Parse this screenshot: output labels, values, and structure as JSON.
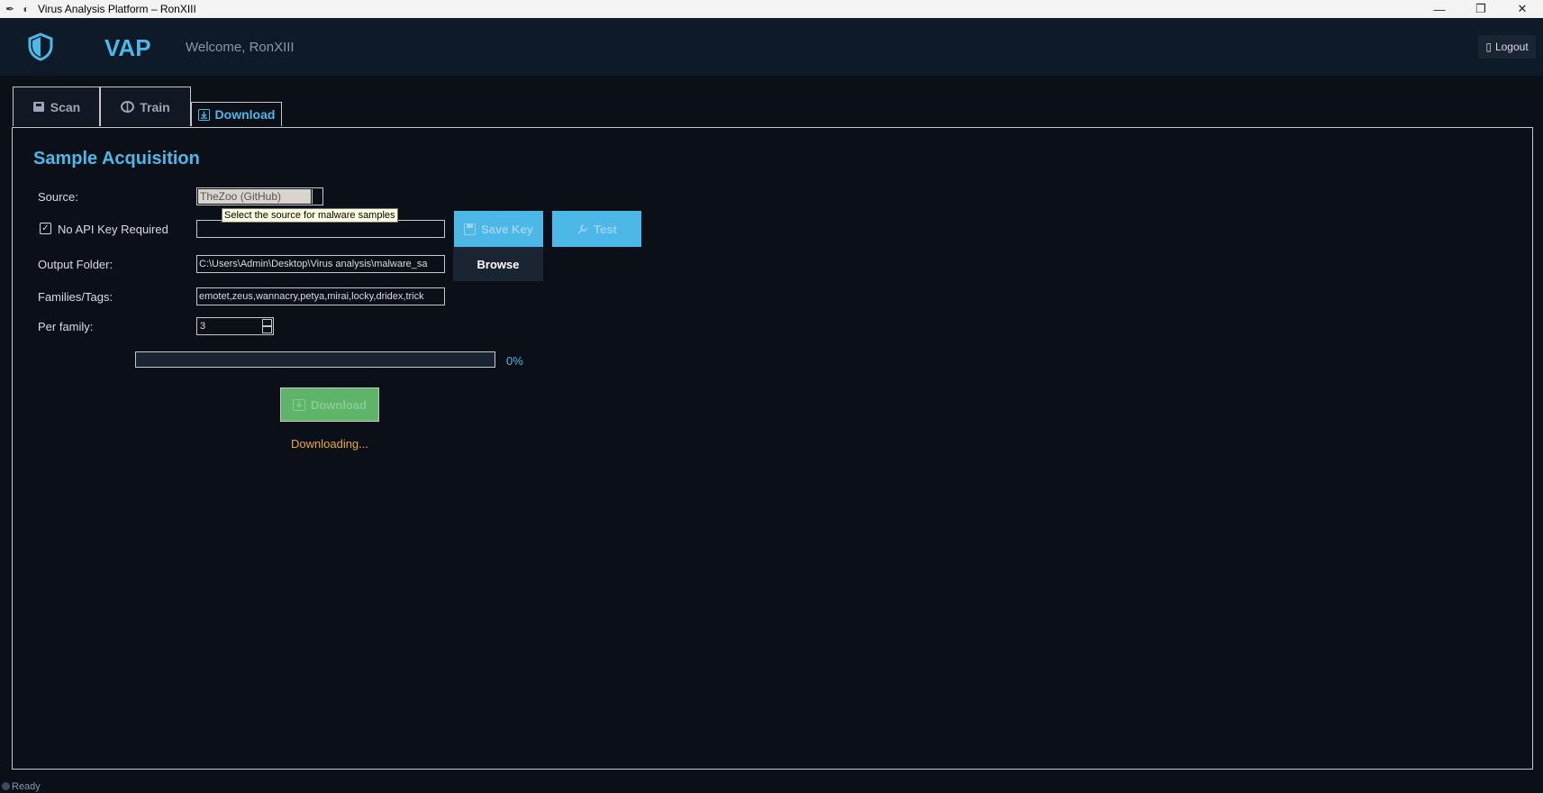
{
  "window": {
    "title": "Virus Analysis Platform – RonXIII",
    "minimize": "—",
    "restore": "❐",
    "close": "✕"
  },
  "header": {
    "app_name": "VAP",
    "welcome": "Welcome, RonXIII",
    "logout_label": "Logout",
    "logout_icon": "▯"
  },
  "tabs": [
    {
      "label": "Scan",
      "icon": "scan-icon"
    },
    {
      "label": "Train",
      "icon": "brain-icon"
    },
    {
      "label": "Download",
      "icon": "download-icon",
      "active": true
    }
  ],
  "main": {
    "title": "Sample Acquisition",
    "source_label": "Source:",
    "source_value": "TheZoo (GitHub)",
    "source_tooltip": "Select the source for malware samples",
    "no_api_key_label": "No API Key Required",
    "no_api_key_checked": true,
    "api_key_value": "",
    "save_key_label": "Save Key",
    "test_label": "Test",
    "output_label": "Output Folder:",
    "output_value": "C:\\Users\\Admin\\Desktop\\Virus analysis\\malware_sa",
    "browse_label": "Browse",
    "families_label": "Families/Tags:",
    "families_value": "emotet,zeus,wannacry,petya,mirai,locky,dridex,trick",
    "per_family_label": "Per family:",
    "per_family_value": "3",
    "progress_fraction": 0,
    "progress_text": "0%",
    "download_label": "Download",
    "download_status": "Downloading..."
  },
  "statusbar": {
    "text": "Ready"
  },
  "colors": {
    "accent": "#4cb8e8",
    "download_green": "#5eb468",
    "warning": "#e8a93a",
    "background": "#0b0f17"
  }
}
